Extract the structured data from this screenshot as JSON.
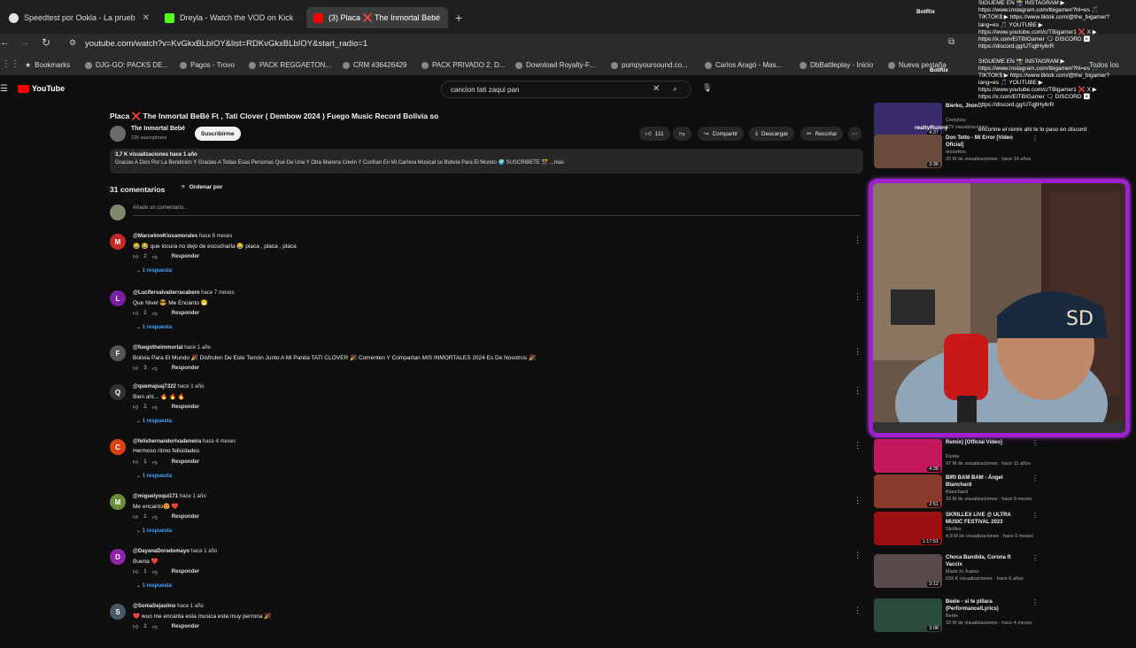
{
  "tabs": [
    {
      "label": "Speedtest por Ookla - La prueb",
      "color": "#e6e6e6"
    },
    {
      "label": "Dreyla - Watch the VOD on Kick",
      "color": "#53fc18"
    },
    {
      "label": "(3) Placa ❌ The Inmortal Bebé",
      "color": "#ff0000",
      "active": true
    }
  ],
  "address": {
    "url": "youtube.com/watch?v=KvGkxBLbIOY&list=RDKvGkxBLbIOY&start_radio=1"
  },
  "bookmarks": [
    "Bookmarks",
    "DJG-GO: PACKS DE...",
    "Pagos - Trovo",
    "PACK REGGAETON...",
    "CRM #36426429",
    "PACK PRIVADO 2. D...",
    "Download Royalty-F...",
    "pumpyoursound.co...",
    "Carlos Aragó - Mas...",
    "DbBattleplay - Inicio",
    "Nueva pestaña",
    "Todos los"
  ],
  "youtube": {
    "logo": "YouTube",
    "search": "cancion tati zaqui pan"
  },
  "video": {
    "title": "Placa ❌ The Inmortal BeBé Ft , Tati Clover ( Dembow 2024 ) Fuego Music Record Bolivia so",
    "channel": "The Inmortal Bebé",
    "subscribers": "225 suscriptores",
    "subscribe": "Suscribirme",
    "likes": "111",
    "share": "Compartir",
    "download": "Descargar",
    "clip": "Recortar",
    "views": "3,7 K visualizaciones  hace 1 año",
    "description": "Gracias A Dios Por La Bendición Y Gracias A Todas Esas Personas Que De Una Y Otra Manera Creén Y Confían En Mi Carrera Musical so Bolivia Para El Mundo 🌍 SUSCRIBETE 🎊 ...más"
  },
  "comments_header": {
    "count": "31 comentarios",
    "sort": "Ordenar por",
    "add": "Añade un comentario..."
  },
  "comments": [
    {
      "handle": "@MarcelinoKiosamorales",
      "time": "hace 6 meses",
      "text": "😂 😂 que locura no dejo de escucharla 😂 placa , placa , placa",
      "likes": "2",
      "replies": "1 respuesta",
      "initial": "M",
      "color": "#c62828"
    },
    {
      "handle": "@Lucifersalvatierracabero",
      "time": "hace 7 meses",
      "text": "Que Nivel 😎 Me Encanto 😁",
      "likes": "2",
      "replies": "1 respuesta",
      "initial": "L",
      "color": "#7b1fa2"
    },
    {
      "handle": "@fuegotheimmortal",
      "time": "hace 1 año",
      "text": "Bolivia Para El Mundo 🎉 Disfruten De Este Temón Junto A Mi Panita TATI CLOVER 🎉 Comenten Y Compartan MIS INMORTALES 2024 Es De Nosotros 🎉",
      "likes": "3",
      "replies": "",
      "initial": "F",
      "color": "#555"
    },
    {
      "handle": "@quemajuaj7322",
      "time": "hace 1 año",
      "text": "Bien ahí... 🔥 🔥 🔥",
      "likes": "2",
      "replies": "1 respuesta",
      "initial": "Q",
      "color": "#333"
    },
    {
      "handle": "@felixhernandorivadeneira",
      "time": "hace 4 meses",
      "text": "Hermoso ritmo felicidades",
      "likes": "1",
      "replies": "1 respuesta",
      "initial": "C",
      "color": "#d84315"
    },
    {
      "handle": "@miguelyoqui171",
      "time": "hace 1 año",
      "text": "Me encanto😍 ❤️",
      "likes": "2",
      "replies": "1 respuesta",
      "initial": "M",
      "color": "#6d8f3c"
    },
    {
      "handle": "@DayanaDoradomayo",
      "time": "hace 1 año",
      "text": "Buena ❤️",
      "likes": "1",
      "replies": "1 respuesta",
      "initial": "D",
      "color": "#8e24aa"
    },
    {
      "handle": "@SoniaSejaslino",
      "time": "hace 1 año",
      "text": "❤️ wuo me encanta esta musica esta muy perrona 🎉",
      "likes": "2",
      "replies": "",
      "initial": "S",
      "color": "#455a64"
    }
  ],
  "comment_reply_label": "Responder",
  "sidebar": [
    {
      "title": "Bierko, Jhon...",
      "channel": "Cestyboy",
      "meta": "679 visualizaciones",
      "dur": "4:37",
      "color": "#3a2a6e"
    },
    {
      "title": "Don Tetto - Mi Error [Video Oficial]",
      "channel": "dontettoo",
      "meta": "20 M de visualizaciones · hace 14 años",
      "dur": "3:36",
      "color": "#6a4a3a"
    },
    {
      "title": "Remix) [Official Video]",
      "channel": "Flume",
      "meta": "97 M de visualizaciones · hace 11 años",
      "dur": "4:38",
      "color": "#c2185b"
    },
    {
      "title": "BIRI BAM BAM - Ángel Blanchard",
      "channel": "Blanchard",
      "meta": "33 M de visualizaciones · hace 9 meses",
      "dur": "2:51",
      "color": "#8a3a2a"
    },
    {
      "title": "SKRILLEX LIVE @ ULTRA MUSIC FESTIVAL 2023",
      "channel": "Skrillex",
      "meta": "4,9 M de visualizaciones · hace 6 meses",
      "dur": "1:17:51",
      "color": "#9a1010"
    },
    {
      "title": "Choca Bandida, Corona ft Vaccix",
      "channel": "Made In Juarez",
      "meta": "639 K visualizaciones · hace 6 años",
      "dur": "3:12",
      "color": "#5a4a4a"
    },
    {
      "title": "Beéle - si te pillara (Performance/Lyrics)",
      "channel": "Beéle",
      "meta": "33 M de visualizaciones · hace 4 meses",
      "dur": "3:08",
      "color": "#2a4a3a"
    }
  ],
  "chat": [
    "SIGUEME EN 📸 INSTAGRAM ▶",
    "https://www.instagram.com/tbigamer/?hl=es 🎵",
    "TIKTOK$ ▶ https://www.tiktok.com/@the_bigamer?",
    "lang=es 🎵 YOUTUBE ▶",
    "https://www.youtube.com/c/TBigamer1 ❌ X ▶",
    "https://x.com/EITBIGamer 🗨 DISCORD ▶",
    "https://discord.gg/UTqjtHy6rR",
    "",
    "SIGUEME EN 📸 INSTAGRAM ▶",
    "https://www.instagram.com/tbigamer/?hl=es 🎵",
    "TIKTOK$ ▶ https://www.tiktok.com/@the_bigamer?",
    "lang=es 🎵 YOUTUBE ▶",
    "https://www.youtube.com/c/TBigamer1 ❌ X ▶",
    "https://x.com/EITBIGamer 🗨 DISCORD ▶",
    "https://discord.gg/UTqjtHy6rR"
  ],
  "chat_extra": [
    "realtyRunny",
    "encontre el remix ahi te lo paso en discord",
    "BotRix",
    "BotRix"
  ]
}
